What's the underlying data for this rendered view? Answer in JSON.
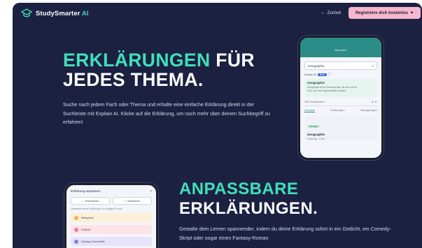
{
  "header": {
    "logo_main": "StudySmarter",
    "logo_ai": "AI",
    "back_label": "Zurück",
    "register_label": "Registriere dich kostenlos"
  },
  "hero1": {
    "title_teal": "ERKLÄRUNGEN",
    "title_white_1": "FÜR",
    "title_white_2": "JEDES THEMA.",
    "text": "Suche nach jedem Fach oder Thema und erhalte eine einfache Erklärung direkt in der Suchleiste mit Explain AI. Klicke auf die Erklärung, um noch mehr über deinen Suchbegriff zu erfahren!"
  },
  "phone1": {
    "header_title": "Erkunden",
    "search_value": "Geographie",
    "explain_label": "Explain AI",
    "explain_pill": "Beta",
    "card_title": "Geographie",
    "card_text": "Geographie ist die Wissenschaft, die sich mit der Erde und ihren Eigenschaften befasst.",
    "row_label": "NEU Explanation",
    "tabs": [
      "Lernsets",
      "Erklärungen",
      "Übungsfragen"
    ],
    "item_badge": "Biologie",
    "item_title": "Geographie",
    "item_text": "Erklärung · 5 Min"
  },
  "phone2": {
    "title": "Erklärung anpassen",
    "btn1": "Vereinfachen",
    "btn2": "Detaillierter",
    "subtitle": "Verwandle deine Erklärung in ein lustiges Format",
    "options": [
      {
        "label": "Metaphern",
        "bg": "#fdf0d8",
        "dot": "#f0b64b"
      },
      {
        "label": "Gedicht",
        "bg": "#fde2e8",
        "dot": "#ee7d98"
      },
      {
        "label": "Fantasy-Geschichte",
        "bg": "#e6e3fb",
        "dot": "#8b7de6"
      }
    ]
  },
  "hero2": {
    "title_line1": "ANPASSBARE",
    "title_line2": "ERKLÄRUNGEN.",
    "text": "Gestalte dein Lernen spannender, indem du deine Erklärung sofort in ein Gedicht, ein Comedy-Skript oder sogar einen Fantasy-Roman"
  },
  "colors": {
    "background": "#1c2142",
    "accent_teal": "#3fe0ba",
    "register_pink": "#f7b6cf"
  }
}
